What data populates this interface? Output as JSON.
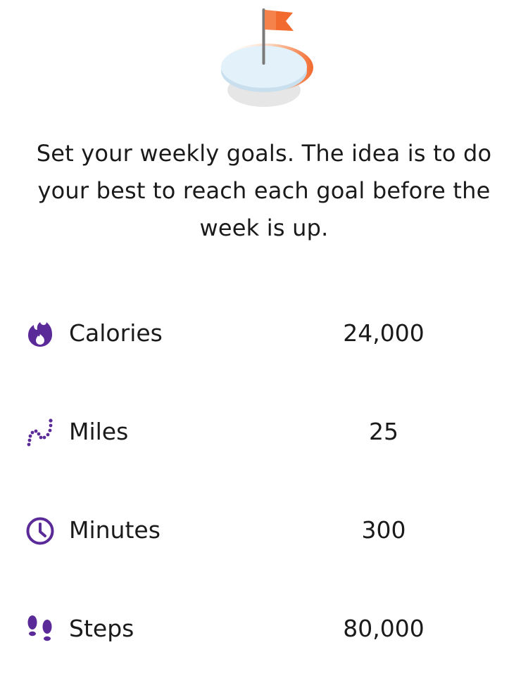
{
  "colors": {
    "accent": "#5b2a99",
    "flag": "#f26a2e",
    "text": "#1a1a1a"
  },
  "hero": {
    "icon": "flag-on-target-icon"
  },
  "intro": {
    "text": "Set your weekly goals. The idea is to do your best to reach each goal before the week is up."
  },
  "goals": [
    {
      "icon": "flame-icon",
      "label": "Calories",
      "value": "24,000"
    },
    {
      "icon": "route-icon",
      "label": "Miles",
      "value": "25"
    },
    {
      "icon": "clock-icon",
      "label": "Minutes",
      "value": "300"
    },
    {
      "icon": "footprints-icon",
      "label": "Steps",
      "value": "80,000"
    }
  ]
}
